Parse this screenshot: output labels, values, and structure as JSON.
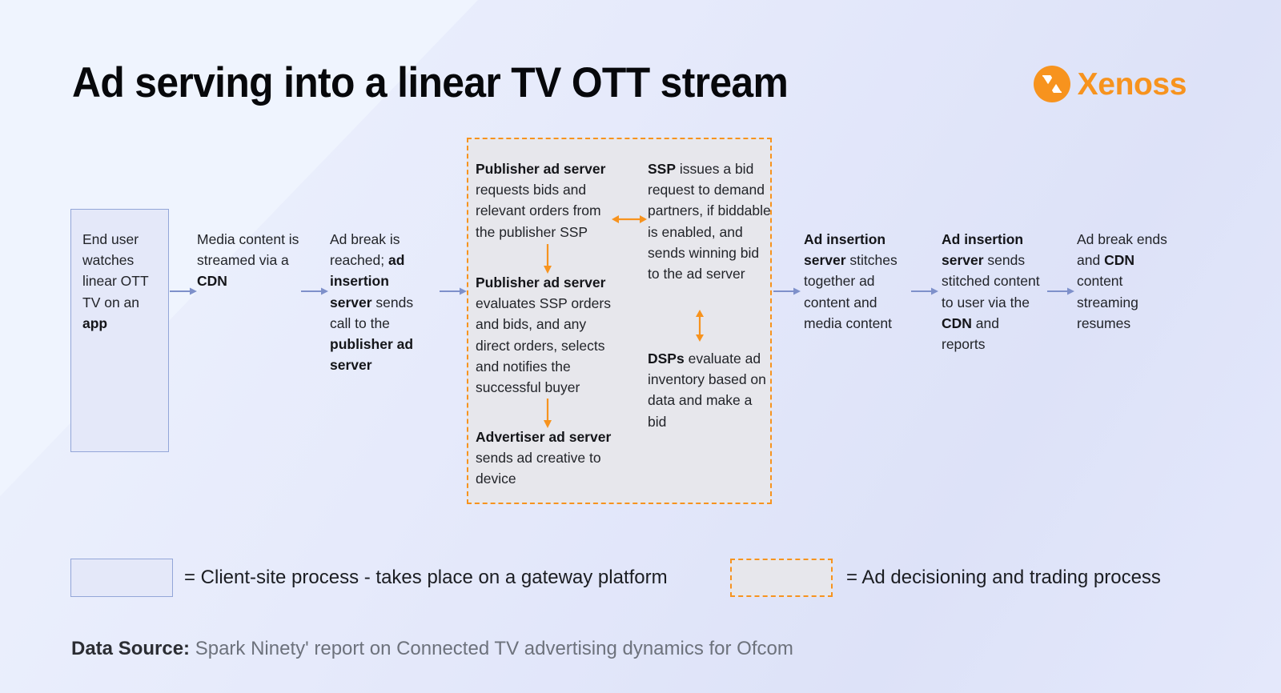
{
  "header": {
    "title": "Ad serving into a linear TV OTT stream",
    "brand": "Xenoss",
    "brand_color": "#f7931e"
  },
  "flow": {
    "steps": [
      {
        "id": "end-user",
        "kind": "client-site-box",
        "segments": [
          {
            "text": "End user watches linear OTT TV on an ",
            "bold": false
          },
          {
            "text": "app",
            "bold": true
          }
        ]
      },
      {
        "id": "media-content",
        "kind": "plain",
        "segments": [
          {
            "text": "Media content is streamed via a ",
            "bold": false
          },
          {
            "text": "CDN",
            "bold": true
          }
        ]
      },
      {
        "id": "ad-break-reached",
        "kind": "plain",
        "segments": [
          {
            "text": "Ad break is reached; ",
            "bold": false
          },
          {
            "text": "ad insertion server",
            "bold": true
          },
          {
            "text": " sends call to the ",
            "bold": false
          },
          {
            "text": "publisher ad server",
            "bold": true
          }
        ]
      },
      {
        "id": "publisher-ad-server-requests",
        "kind": "decisioning",
        "segments": [
          {
            "text": "Publisher ad server",
            "bold": true
          },
          {
            "text": " requests bids and relevant orders from the publisher SSP",
            "bold": false
          }
        ]
      },
      {
        "id": "publisher-ad-server-evaluates",
        "kind": "decisioning",
        "segments": [
          {
            "text": "Publisher ad server",
            "bold": true
          },
          {
            "text": " evaluates SSP orders and bids, and any direct orders, selects and notifies the successful buyer",
            "bold": false
          }
        ]
      },
      {
        "id": "advertiser-ad-server",
        "kind": "decisioning",
        "segments": [
          {
            "text": "Advertiser ad server",
            "bold": true
          },
          {
            "text": " sends ad creative to device",
            "bold": false
          }
        ]
      },
      {
        "id": "ssp-bid-request",
        "kind": "decisioning",
        "segments": [
          {
            "text": "SSP",
            "bold": true
          },
          {
            "text": " issues a bid request to demand partners, if biddable is enabled, and sends winning bid to the ad server",
            "bold": false
          }
        ]
      },
      {
        "id": "dsps-evaluate",
        "kind": "decisioning",
        "segments": [
          {
            "text": "DSPs",
            "bold": true
          },
          {
            "text": " evaluate ad inventory based on data and make a bid",
            "bold": false
          }
        ]
      },
      {
        "id": "ad-insertion-stitches",
        "kind": "plain",
        "segments": [
          {
            "text": "Ad insertion server",
            "bold": true
          },
          {
            "text": " stitches together ad content and media content",
            "bold": false
          }
        ]
      },
      {
        "id": "ad-insertion-sends",
        "kind": "plain",
        "segments": [
          {
            "text": "Ad insertion server",
            "bold": true
          },
          {
            "text": " sends stitched content to user via the ",
            "bold": false
          },
          {
            "text": "CDN",
            "bold": true
          },
          {
            "text": " and reports",
            "bold": false
          }
        ]
      },
      {
        "id": "ad-break-ends",
        "kind": "plain",
        "segments": [
          {
            "text": "Ad break ends and ",
            "bold": false
          },
          {
            "text": "CDN",
            "bold": true
          },
          {
            "text": " content streaming resumes",
            "bold": false
          }
        ]
      }
    ]
  },
  "legend": {
    "client_site": "= Client-site process - takes place on a gateway platform",
    "decisioning": "= Ad decisioning and trading process",
    "client_site_fill": "#e4e8f9",
    "client_site_border": "#93a6d8",
    "decisioning_fill": "#e7e7ec",
    "decisioning_border": "#f7931e"
  },
  "footer": {
    "source_label": "Data Source:",
    "source_text": "Spark Ninety' report on Connected TV advertising dynamics for Ofcom"
  }
}
